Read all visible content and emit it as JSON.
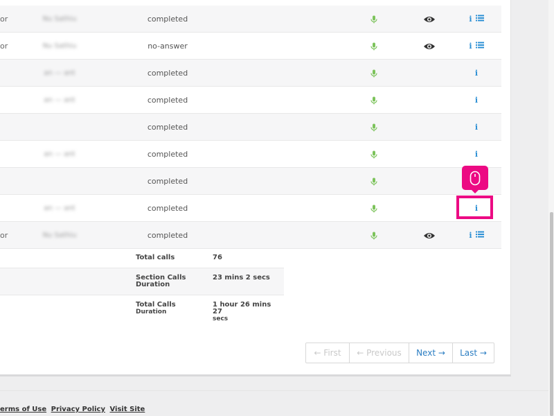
{
  "rows": [
    {
      "frag": "or",
      "blurred_name": "Nu Sathiu",
      "status": "completed",
      "has_eye": true,
      "has_list": true
    },
    {
      "frag": "or",
      "blurred_name": "Nu Sathiu",
      "status": "no-answer",
      "has_eye": true,
      "has_list": true
    },
    {
      "frag": "",
      "blurred_name": "an — ant",
      "status": "completed",
      "has_eye": false,
      "has_list": false
    },
    {
      "frag": "",
      "blurred_name": "an — ant",
      "status": "completed",
      "has_eye": false,
      "has_list": false
    },
    {
      "frag": "",
      "blurred_name": "",
      "status": "completed",
      "has_eye": false,
      "has_list": false
    },
    {
      "frag": "",
      "blurred_name": "an — ant",
      "status": "completed",
      "has_eye": false,
      "has_list": false
    },
    {
      "frag": "",
      "blurred_name": "",
      "status": "completed",
      "has_eye": false,
      "has_list": false
    },
    {
      "frag": "",
      "blurred_name": "an — ant",
      "status": "completed",
      "has_eye": false,
      "has_list": false
    },
    {
      "frag": "or",
      "blurred_name": "Nu Sathiu",
      "status": "completed",
      "has_eye": true,
      "has_list": true
    }
  ],
  "summary": {
    "total_calls_label": "Total calls",
    "total_calls_value": "76",
    "section_duration_label": "Section Calls",
    "section_duration_label_2": "Duration",
    "section_duration_value": "23 mins 2 secs",
    "total_duration_label": "Total Calls",
    "total_duration_label_2": "Duration",
    "total_duration_value": "1 hour 26 mins 27",
    "total_duration_value_2": "secs"
  },
  "pagination": {
    "first": "← First",
    "previous": "← Previous",
    "next": "Next →",
    "last": "Last →"
  },
  "footer": {
    "terms": "erms of Use",
    "privacy": "Privacy Policy",
    "visit": "Visit Site"
  },
  "colors": {
    "accent": "#2b8fd4",
    "mic": "#7cc35b",
    "highlight": "#ec0a83"
  }
}
